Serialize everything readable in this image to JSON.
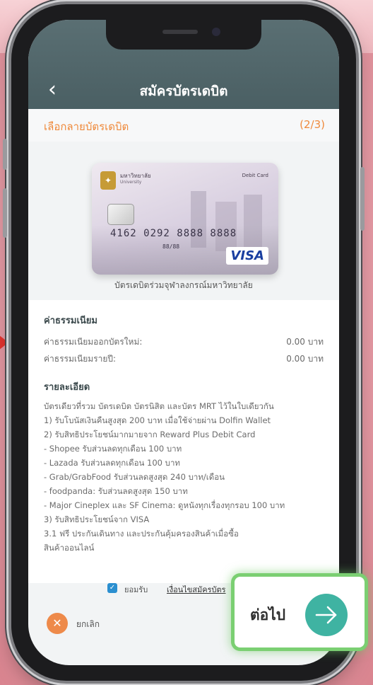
{
  "header": {
    "title": "สมัครบัตรเดบิต",
    "back_symbol": "‹"
  },
  "subheader": {
    "title": "เลือกลายบัตรเดบิต",
    "step": "(2/3)"
  },
  "card": {
    "bank_name": "มหาวิทยาลัย",
    "bank_name_en": "University",
    "card_type": "Debit Card",
    "number": "4162 0292 8888 8888",
    "expiry": "88/88",
    "network": "VISA",
    "caption": "บัตรเดบิตร่วมจุฬาลงกรณ์มหาวิทยาลัย"
  },
  "fees": {
    "heading": "ค่าธรรมเนียม",
    "rows": [
      {
        "label": "ค่าธรรมเนียมออกบัตรใหม่:",
        "value": "0.00 บาท"
      },
      {
        "label": "ค่าธรรมเนียมรายปี:",
        "value": "0.00 บาท"
      }
    ]
  },
  "details": {
    "heading": "รายละเอียด",
    "lines": [
      "บัตรเดียวที่รวม บัตรเดบิต บัตรนิสิต และบัตร MRT ไว้ในใบเดียวกัน",
      "1) รับโบนัสเงินคืนสูงสุด 200 บาท เมื่อใช้จ่ายผ่าน Dolfin Wallet",
      "2) รับสิทธิประโยชน์มากมายจาก Reward Plus Debit Card",
      "- Shopee รับส่วนลดทุกเดือน 100 บาท",
      "- Lazada รับส่วนลดทุกเดือน 100 บาท",
      "- Grab/GrabFood รับส่วนลดสูงสุด 240 บาท/เดือน",
      "- foodpanda: รับส่วนลดสูงสุด 150 บาท",
      "- Major Cineplex และ SF Cinema: ดูหนังทุกเรื่องทุกรอบ 100 บาท",
      "3) รับสิทธิประโยชน์จาก VISA",
      "3.1 ฟรี ประกันเดินทาง และประกันคุ้มครองสินค้าเมื่อซื้อ",
      "สินค้าออนไลน์"
    ]
  },
  "agreement": {
    "checkbox_state": "checked",
    "label": "ยอมรับ",
    "link": "เงื่อนไขสมัครบัตร"
  },
  "actions": {
    "cancel_label": "ยกเลิก",
    "cancel_symbol": "✕",
    "next_label": "ต่อไป"
  },
  "colors": {
    "header": "#4f6468",
    "accent_orange": "#ef8a3c",
    "next_button": "#3fb3a2",
    "highlight": "#7bcf72"
  }
}
